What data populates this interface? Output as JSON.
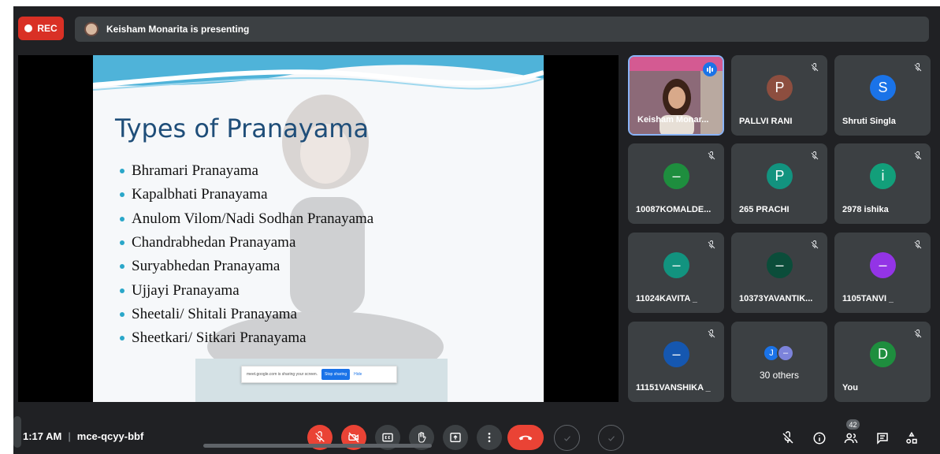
{
  "top": {
    "rec_label": "REC",
    "presenting_text": "Keisham Monarita is presenting"
  },
  "slide": {
    "title": "Types of Pranayama",
    "bullets": [
      "Bhramari Pranayama",
      "Kapalbhati Pranayama",
      "Anulom Vilom/Nadi Sodhan Pranayama",
      "Chandrabhedan Pranayama",
      "Suryabhedan Pranayama",
      "Ujjayi Pranayama",
      "Sheetali/ Shitali Pranayama",
      "Sheetkari/ Sitkari Pranayama"
    ],
    "share_notice": "meet.google.com is sharing your screen.",
    "stop_sharing": "Stop sharing",
    "hide": "Hide"
  },
  "participants": [
    {
      "name": "Keisham Monar...",
      "video": true,
      "speaking": true
    },
    {
      "name": "PALLVI RANI",
      "initial": "P",
      "color": "#8d4e3f",
      "muted": true
    },
    {
      "name": "Shruti Singla",
      "initial": "S",
      "color": "#1a73e8",
      "muted": true
    },
    {
      "name": "10087KOMALDE...",
      "initial": "–",
      "color": "#1e8e3e",
      "muted": true
    },
    {
      "name": "265 PRACHI",
      "initial": "P",
      "color": "#12937f",
      "muted": true
    },
    {
      "name": "2978 ishika",
      "initial": "i",
      "color": "#129f7a",
      "muted": true
    },
    {
      "name": "11024KAVITA _",
      "initial": "–",
      "color": "#12937f",
      "muted": true
    },
    {
      "name": "10373YAVANTIK...",
      "initial": "–",
      "color": "#0b4d3a",
      "muted": true
    },
    {
      "name": "1105TANVI _",
      "initial": "–",
      "color": "#9334e6",
      "muted": true
    },
    {
      "name": "11151VANSHIKA _",
      "initial": "–",
      "color": "#1557b0",
      "muted": true
    },
    {
      "name": "You",
      "initial": "D",
      "color": "#1e8e3e",
      "muted": true
    }
  ],
  "others": {
    "label": "30 others",
    "avatars": [
      {
        "initial": "J",
        "color": "#1a73e8"
      },
      {
        "initial": "–",
        "color": "#7c83db"
      }
    ]
  },
  "bottom": {
    "time": "1:17 AM",
    "separator": "|",
    "meeting_code": "mce-qcyy-bbf",
    "people_count": "42"
  },
  "colors": {
    "background": "#202124",
    "tile": "#3c4043",
    "danger": "#ea4335",
    "accent": "#1a73e8"
  },
  "icons": [
    "mic-off-icon",
    "camera-off-icon",
    "captions-icon",
    "raise-hand-icon",
    "present-icon",
    "more-options-icon",
    "end-call-icon",
    "info-icon",
    "people-icon",
    "chat-icon",
    "activities-icon"
  ]
}
